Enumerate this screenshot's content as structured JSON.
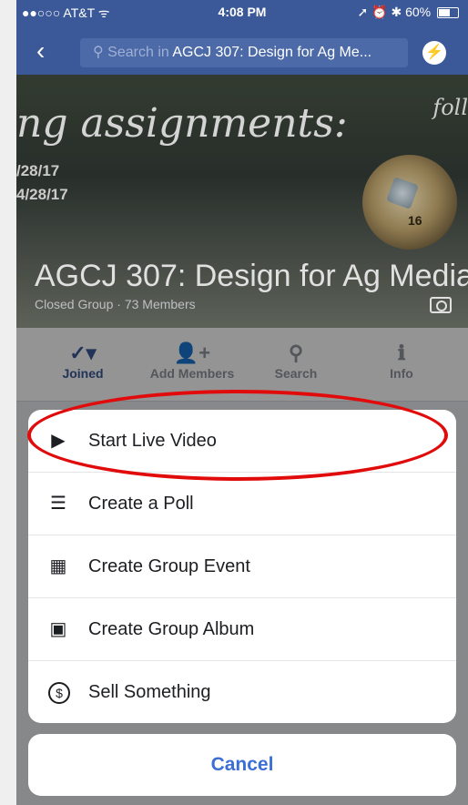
{
  "status_bar": {
    "carrier": "●●○○○ AT&T ᯤ",
    "time": "4:08 PM",
    "right": "➚ ⏰ ✱ 60%",
    "battery_level": 0.6
  },
  "nav": {
    "back_glyph": "‹",
    "search_prefix": "Search in ",
    "search_value": "AGCJ 307: Design for Ag Me...",
    "messenger_glyph": "⚡"
  },
  "cover": {
    "script_text": "ng assignments:",
    "script_right": "foll",
    "date1": "/28/17",
    "date2": "4/28/17",
    "ring_number": "16",
    "group_title": "AGCJ 307: Design for Ag Media",
    "group_meta": "Closed Group · 73 Members"
  },
  "actions": [
    {
      "label": "Joined",
      "icon": "✓▾"
    },
    {
      "label": "Add Members",
      "icon": "👤+"
    },
    {
      "label": "Search",
      "icon": "⚲"
    },
    {
      "label": "Info",
      "icon": "ℹ"
    }
  ],
  "sheet": {
    "items": [
      {
        "label": "Start Live Video",
        "icon": "▶"
      },
      {
        "label": "Create a Poll",
        "icon": "☰"
      },
      {
        "label": "Create Group Event",
        "icon": "▦"
      },
      {
        "label": "Create Group Album",
        "icon": "▣"
      },
      {
        "label": "Sell Something",
        "icon": "$"
      }
    ],
    "cancel": "Cancel"
  },
  "colors": {
    "facebook_blue": "#3b5998",
    "cancel_blue": "#3b6fd6",
    "annotation_red": "#e10b0b"
  }
}
